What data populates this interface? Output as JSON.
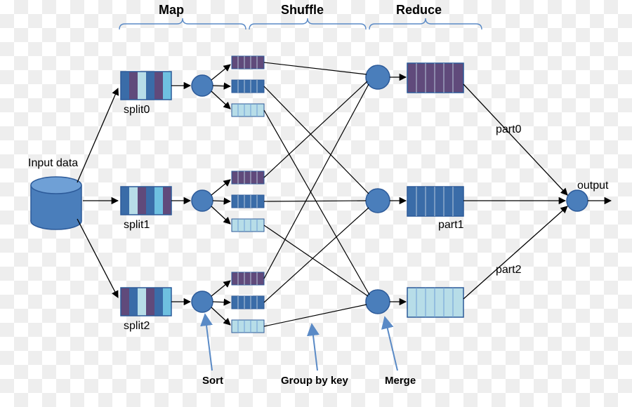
{
  "headers": {
    "map": "Map",
    "shuffle": "Shuffle",
    "reduce": "Reduce"
  },
  "labels": {
    "input": "Input data",
    "split0": "split0",
    "split1": "split1",
    "split2": "split2",
    "part0": "part0",
    "part1": "part1",
    "part2": "part2",
    "output": "output",
    "sort": "Sort",
    "groupby": "Group by key",
    "merge": "Merge"
  },
  "colors": {
    "blue_fill": "#4A7EBB",
    "blue_stroke": "#2C5A99",
    "purple": "#604A7B",
    "midblue": "#3A6CA8",
    "lightblue": "#B7DDE8",
    "skyblue": "#6EC0E0",
    "annot_arrow": "#5A8AC6"
  }
}
